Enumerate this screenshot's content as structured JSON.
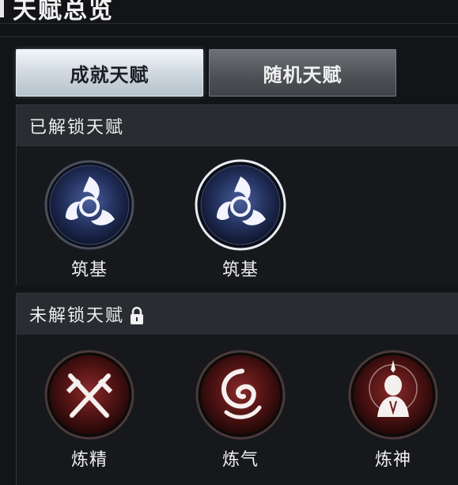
{
  "header": {
    "title": "天赋总览"
  },
  "tabs": [
    {
      "label": "成就天赋",
      "active": true
    },
    {
      "label": "随机天赋",
      "active": false
    }
  ],
  "sections": {
    "unlocked": {
      "title": "已解锁天赋",
      "talents": [
        {
          "name": "筑基",
          "icon": "swirl-blade-icon",
          "selected": false
        },
        {
          "name": "筑基",
          "icon": "swirl-blade-icon",
          "selected": true
        }
      ]
    },
    "locked": {
      "title": "未解锁天赋",
      "lock_icon": "lock-icon",
      "talents": [
        {
          "name": "炼精",
          "icon": "crossed-swords-icon"
        },
        {
          "name": "炼气",
          "icon": "spiral-qi-icon"
        },
        {
          "name": "炼神",
          "icon": "meditating-figure-icon"
        }
      ]
    }
  },
  "colors": {
    "background": "#121417",
    "unlocked_orb": "#2a3a6e",
    "locked_orb": "#6a1a1a",
    "tab_active": "#cdd6de",
    "tab_inactive": "#4d5054"
  }
}
